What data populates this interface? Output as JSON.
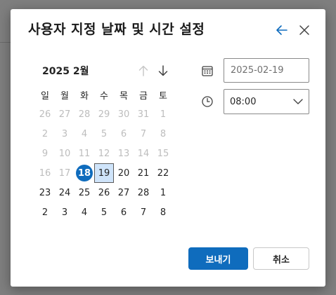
{
  "dialog": {
    "title": "사용자 지정 날짜 및 시간 설정",
    "back_icon": "arrow-left-icon",
    "close_icon": "close-icon"
  },
  "calendar": {
    "month_label": "2025 2월",
    "weekdays": [
      "일",
      "월",
      "화",
      "수",
      "목",
      "금",
      "토"
    ],
    "weeks": [
      [
        "26",
        "27",
        "28",
        "29",
        "30",
        "31",
        "1"
      ],
      [
        "2",
        "3",
        "4",
        "5",
        "6",
        "7",
        "8"
      ],
      [
        "9",
        "10",
        "11",
        "12",
        "13",
        "14",
        "15"
      ],
      [
        "16",
        "17",
        "18",
        "19",
        "20",
        "21",
        "22"
      ],
      [
        "23",
        "24",
        "25",
        "26",
        "27",
        "28",
        "1"
      ],
      [
        "2",
        "3",
        "4",
        "5",
        "6",
        "7",
        "8"
      ]
    ]
  },
  "fields": {
    "date_value": "2025-02-19",
    "time_value": "08:00"
  },
  "buttons": {
    "send": "보내기",
    "cancel": "취소"
  },
  "colors": {
    "accent": "#0f6cbd",
    "selected_bg": "#cfe4fa"
  }
}
